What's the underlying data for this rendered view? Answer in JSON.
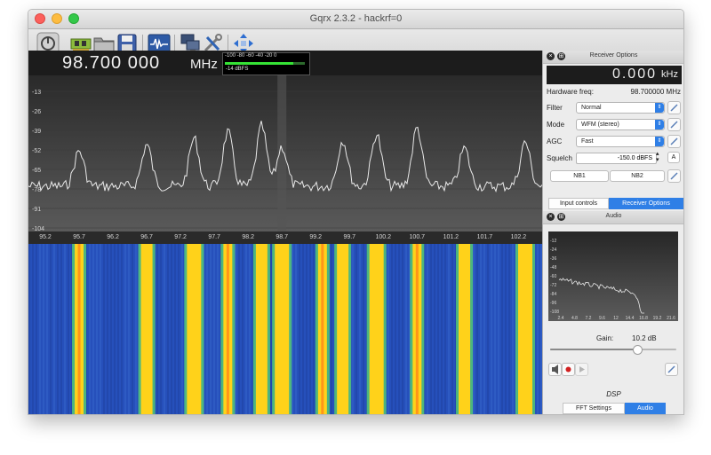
{
  "window": {
    "title": "Gqrx 2.3.2 - hackrf=0"
  },
  "toolbar": {
    "buttons": [
      {
        "name": "power-button",
        "icon": "power-icon"
      },
      {
        "name": "device-config-button",
        "icon": "circuit-board-icon"
      },
      {
        "name": "open-button",
        "icon": "folder-icon"
      },
      {
        "name": "save-button",
        "icon": "floppy-disk-icon"
      },
      {
        "name": "dsp-button",
        "icon": "waveform-icon"
      },
      {
        "name": "remote-control-button",
        "icon": "network-icon"
      },
      {
        "name": "settings-button",
        "icon": "tools-icon"
      },
      {
        "name": "fullscreen-button",
        "icon": "arrows-icon"
      }
    ]
  },
  "frequency": {
    "digits": "98.700 000",
    "unit": "MHz"
  },
  "meter": {
    "scale": "-100  -80  -60  -40  -20  0",
    "value": "-14 dBFS",
    "level_fraction": 0.86
  },
  "spectrum": {
    "y_ticks": [
      "-13",
      "-26",
      "-39",
      "-52",
      "-65",
      "-78",
      "-91",
      "-104"
    ],
    "x_ticks": [
      "95.2",
      "95.7",
      "96.2",
      "96.7",
      "97.2",
      "97.7",
      "98.2",
      "98.7",
      "99.2",
      "99.7",
      "100.2",
      "100.7",
      "101.2",
      "101.7",
      "102.2"
    ],
    "peak_freqs": [
      95.7,
      96.7,
      97.4,
      97.9,
      98.4,
      98.7,
      99.6,
      100.1,
      100.7,
      101.4,
      102.3
    ],
    "colors": {
      "background": "#262626",
      "trace": "#e9e9e9",
      "grid": "#3a3a3a",
      "center_band": "#555555"
    }
  },
  "waterfall": {
    "bright_bands": [
      95.7,
      96.7,
      97.4,
      97.9,
      98.4,
      98.7,
      99.3,
      99.6,
      100.1,
      100.7,
      101.4,
      102.3
    ],
    "colors": {
      "base": "#2650bb",
      "hot": "#ffd21a",
      "warm": "#58d070",
      "peak": "#ff7b1a"
    }
  },
  "receiver_options": {
    "title": "Receiver Options",
    "rx_freq": {
      "digits": "0.000",
      "unit": "kHz"
    },
    "hardware_freq_label": "Hardware freq:",
    "hardware_freq_value": "98.700000 MHz",
    "filter_label": "Filter",
    "filter_value": "Normal",
    "mode_label": "Mode",
    "mode_value": "WFM (stereo)",
    "agc_label": "AGC",
    "agc_value": "Fast",
    "squelch_label": "Squelch",
    "squelch_value": "-150.0 dBFS",
    "squelch_auto": "A",
    "nb1_label": "NB1",
    "nb2_label": "NB2",
    "tabs": [
      "Input controls",
      "Receiver Options"
    ],
    "active_tab": 1
  },
  "audio": {
    "title": "Audio",
    "y_ticks": [
      "-12",
      "-24",
      "-36",
      "-48",
      "-60",
      "-72",
      "-84",
      "-96",
      "-108"
    ],
    "x_ticks": [
      "2.4",
      "4.8",
      "7.2",
      "9.6",
      "12",
      "14.4",
      "16.8",
      "19.2",
      "21.6"
    ],
    "gain_label": "Gain:",
    "gain_value": "10.2 dB",
    "gain_fraction": 0.69,
    "dsp_label": "DSP",
    "tabs": [
      "FFT Settings",
      "Audio"
    ],
    "active_tab": 1
  }
}
